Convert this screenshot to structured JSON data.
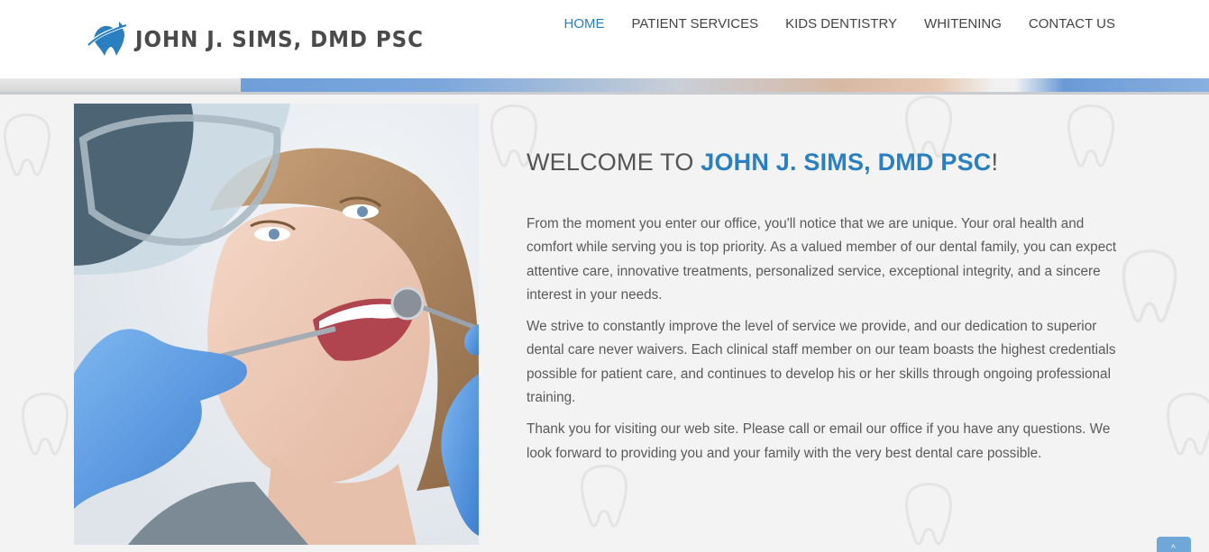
{
  "header": {
    "logo_text": "JOHN J. SIMS, DMD PSC",
    "nav": [
      {
        "label": "HOME",
        "active": true
      },
      {
        "label": "PATIENT SERVICES",
        "active": false
      },
      {
        "label": "KIDS DENTISTRY",
        "active": false
      },
      {
        "label": "WHITENING",
        "active": false
      },
      {
        "label": "CONTACT US",
        "active": false
      }
    ]
  },
  "main": {
    "welcome_prefix": "WELCOME TO ",
    "welcome_brand": "JOHN J. SIMS, DMD PSC",
    "welcome_suffix": "!",
    "paragraphs": [
      "From the moment you enter our office, you'll notice that we are unique. Your oral health and comfort while serving you is top priority. As a valued member of our dental family, you can expect attentive care, innovative treatments, personalized service, exceptional integrity, and a sincere interest in your needs.",
      "We strive to constantly improve the level of service we provide, and our dedication to superior dental care never waivers. Each clinical staff member on our team boasts the highest credentials possible for patient care, and continues to develop his or her skills through ongoing professional training.",
      "Thank you for visiting our web site. Please call or email our office if you have any questions. We look forward to providing you and your family with the very best dental care possible."
    ]
  },
  "scroll_top": {
    "icon": "chevron-up-icon",
    "glyph": "^"
  },
  "colors": {
    "accent": "#2a7fc0",
    "text": "#5a5a5a",
    "header_text": "#444444"
  }
}
